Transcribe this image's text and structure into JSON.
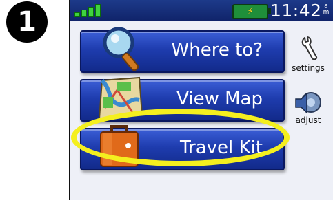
{
  "step_number": "1",
  "status": {
    "time": "11:42",
    "am_pm_top": "a",
    "am_pm_bottom": "m",
    "signal_bars": 4,
    "battery_charging": true,
    "colors": {
      "bar": "#10246a",
      "signal": "#3fd23f",
      "battery": "#1f8f3a"
    }
  },
  "menu": [
    {
      "label": "Where to?",
      "icon": "magnifier-icon"
    },
    {
      "label": "View Map",
      "icon": "map-icon"
    },
    {
      "label": "Travel Kit",
      "icon": "suitcase-icon"
    }
  ],
  "side": [
    {
      "label": "settings",
      "icon": "wrench-icon"
    },
    {
      "label": "adjust",
      "icon": "speaker-icon"
    }
  ],
  "highlight_color": "#f4ef1f",
  "button_color": "#1e3cae"
}
